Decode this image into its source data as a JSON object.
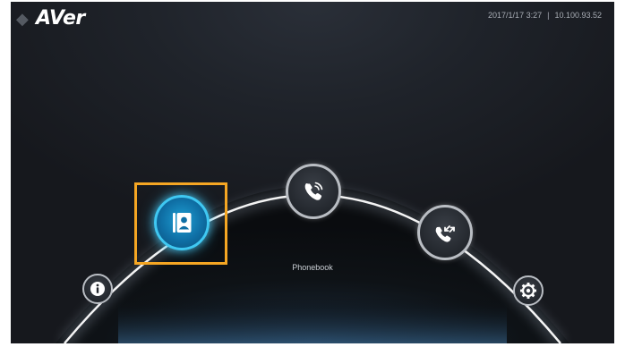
{
  "header": {
    "logo_text": "AVer",
    "datetime": "2017/1/17 3:27",
    "separator": "|",
    "ip_address": "10.100.93.52"
  },
  "menu": {
    "focused_caption": "Phonebook",
    "items": [
      {
        "id": "info",
        "icon": "info-icon",
        "state": "normal"
      },
      {
        "id": "phonebook",
        "icon": "contact-book-icon",
        "state": "selected"
      },
      {
        "id": "call",
        "icon": "phone-ring-icon",
        "state": "normal"
      },
      {
        "id": "call-history",
        "icon": "phone-arrows-icon",
        "state": "normal"
      },
      {
        "id": "settings",
        "icon": "gear-icon",
        "state": "normal"
      }
    ]
  },
  "colors": {
    "selected_accent": "#3fc8f2",
    "focus_frame": "#f5a623",
    "arc_glow": "#ffffff"
  }
}
